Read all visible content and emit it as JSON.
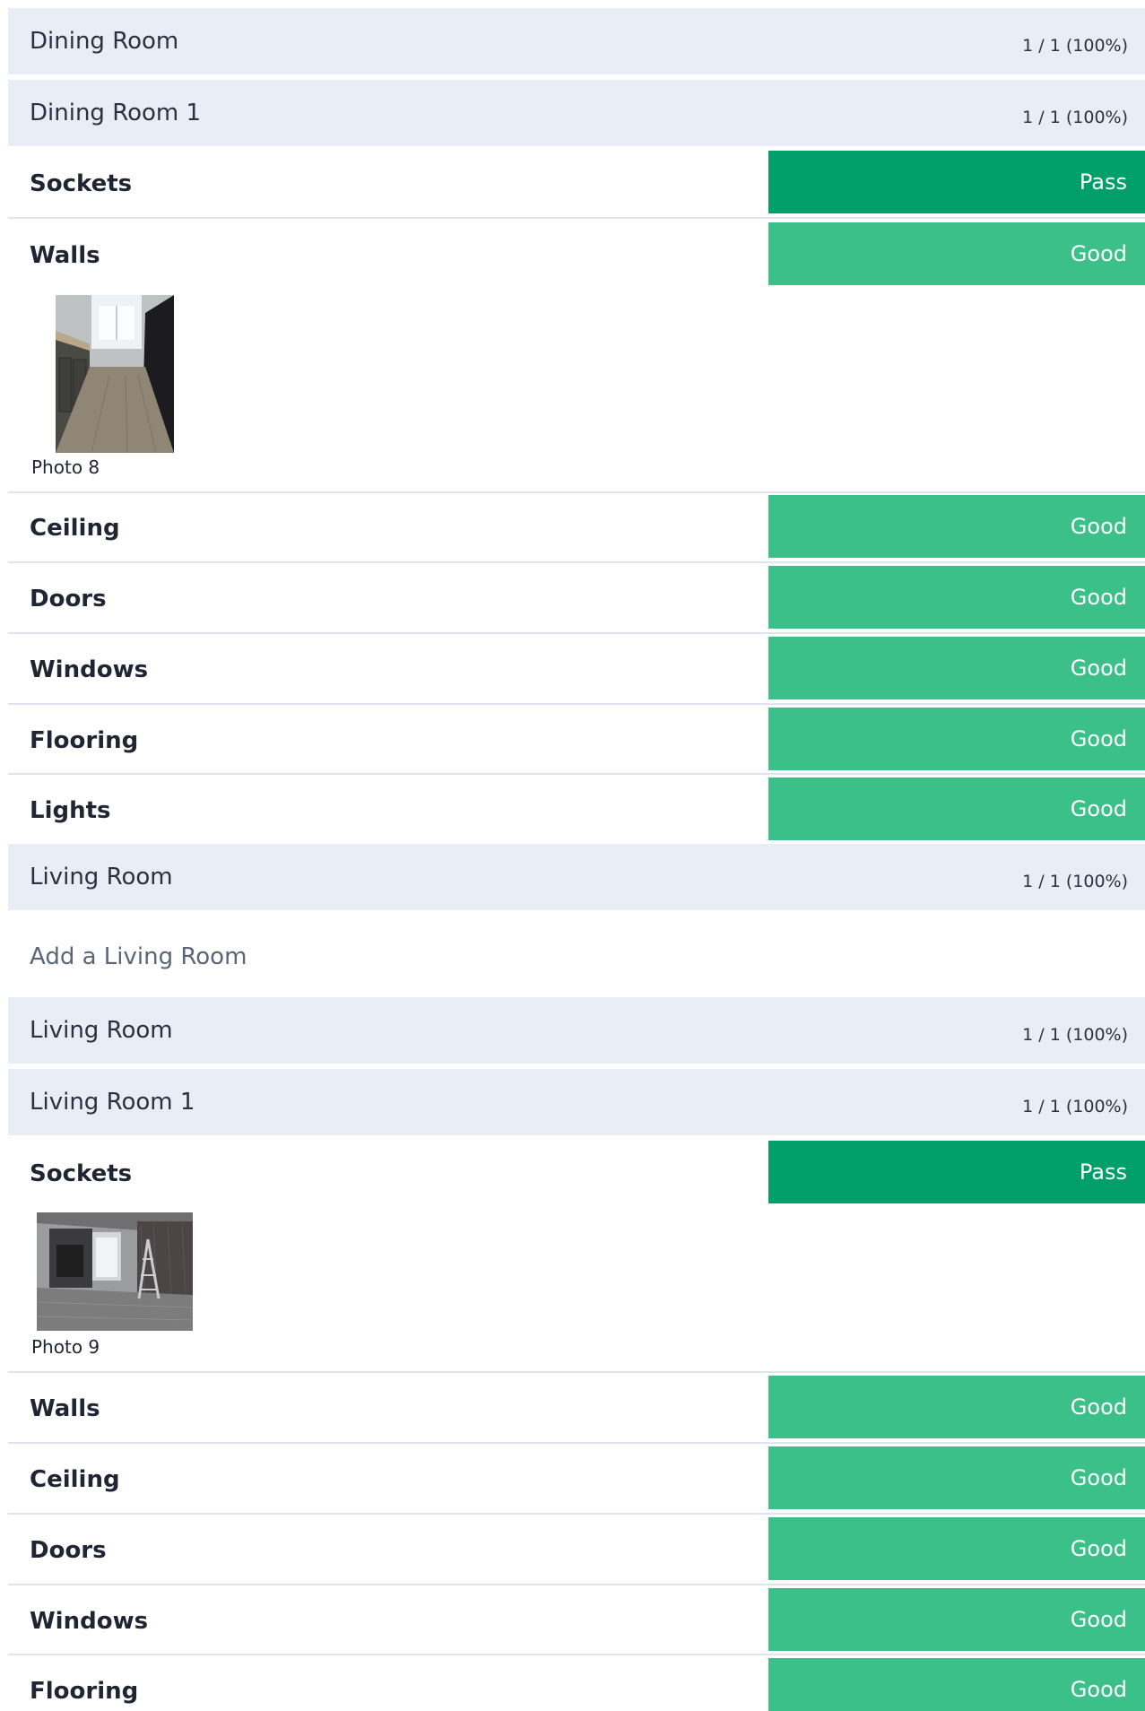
{
  "rooms": {
    "dining_header": {
      "title": "Dining Room",
      "score": "1 / 1 (100%)"
    },
    "dining_1": {
      "title": "Dining Room 1",
      "score": "1 / 1 (100%)"
    },
    "dining_items": [
      {
        "name": "Sockets",
        "status": "Pass"
      },
      {
        "name": "Walls",
        "status": "Good"
      },
      {
        "name": "Ceiling",
        "status": "Good"
      },
      {
        "name": "Doors",
        "status": "Good"
      },
      {
        "name": "Windows",
        "status": "Good"
      },
      {
        "name": "Flooring",
        "status": "Good"
      },
      {
        "name": "Lights",
        "status": "Good"
      }
    ],
    "dining_photo": {
      "caption": "Photo 8"
    },
    "living_header_a": {
      "title": "Living Room",
      "score": "1 / 1 (100%)"
    },
    "add_living_room": "Add a Living Room",
    "living_header_b": {
      "title": "Living Room",
      "score": "1 / 1 (100%)"
    },
    "living_1": {
      "title": "Living Room 1",
      "score": "1 / 1 (100%)"
    },
    "living_items": [
      {
        "name": "Sockets",
        "status": "Pass"
      },
      {
        "name": "Walls",
        "status": "Good"
      },
      {
        "name": "Ceiling",
        "status": "Good"
      },
      {
        "name": "Doors",
        "status": "Good"
      },
      {
        "name": "Windows",
        "status": "Good"
      },
      {
        "name": "Flooring",
        "status": "Good"
      }
    ],
    "living_photo": {
      "caption": "Photo 9"
    }
  },
  "colors": {
    "section_bg": "#e8edf6",
    "pass": "#009e68",
    "good": "#3cc08a"
  }
}
